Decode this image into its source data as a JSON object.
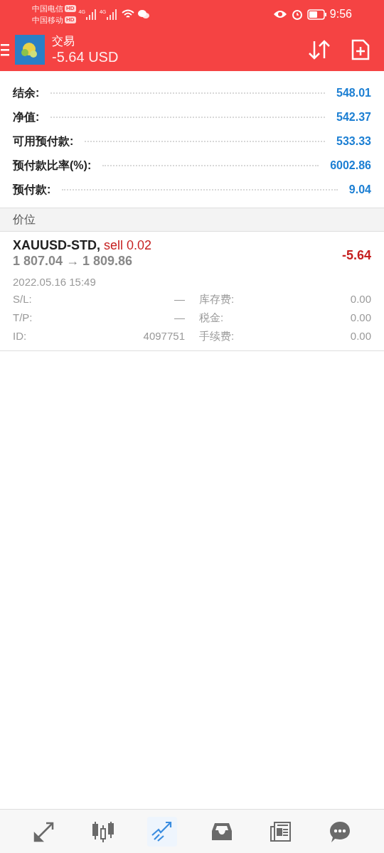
{
  "status_bar": {
    "carriers": [
      {
        "name": "中国电信",
        "badge": "HD"
      },
      {
        "name": "中国移动",
        "badge": "HD"
      }
    ],
    "signals": [
      "4G",
      "4G"
    ],
    "time": "9:56"
  },
  "header": {
    "title": "交易",
    "subtitle": "-5.64 USD"
  },
  "summary": [
    {
      "label": "结余:",
      "value": "548.01"
    },
    {
      "label": "净值:",
      "value": "542.37"
    },
    {
      "label": "可用预付款:",
      "value": "533.33"
    },
    {
      "label": "预付款比率(%):",
      "value": "6002.86"
    },
    {
      "label": "预付款:",
      "value": "9.04"
    }
  ],
  "section_title": "价位",
  "positions": [
    {
      "symbol": "XAUUSD-STD,",
      "side": "sell 0.02",
      "prices": "1 807.04 → 1 809.86",
      "profit": "-5.64",
      "time": "2022.05.16 15:49",
      "details": [
        {
          "left_label": "S/L:",
          "left_value": "—",
          "right_label": "库存费:",
          "right_value": "0.00"
        },
        {
          "left_label": "T/P:",
          "left_value": "—",
          "right_label": "税金:",
          "right_value": "0.00"
        },
        {
          "left_label": "ID:",
          "left_value": "4097751",
          "right_label": "手续费:",
          "right_value": "0.00"
        }
      ]
    }
  ],
  "nav": [
    {
      "kind": "trade",
      "selected": false
    },
    {
      "kind": "chart",
      "selected": false
    },
    {
      "kind": "history",
      "selected": true
    },
    {
      "kind": "inbox",
      "selected": false
    },
    {
      "kind": "news",
      "selected": false
    },
    {
      "kind": "chat",
      "selected": false
    }
  ]
}
